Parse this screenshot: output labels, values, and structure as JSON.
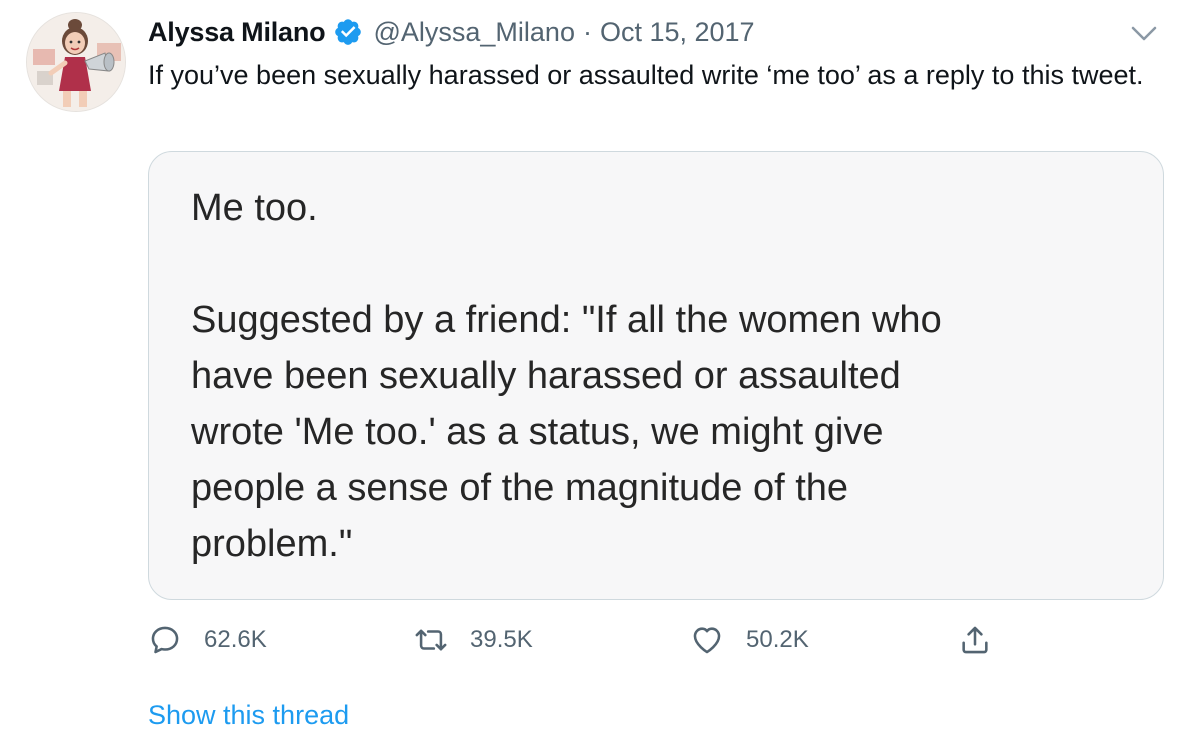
{
  "tweet": {
    "author": {
      "display_name": "Alyssa Milano",
      "verified": true,
      "handle": "@Alyssa_Milano",
      "avatar_icon": "cartoon-avatar-icon"
    },
    "separator": "·",
    "date": "Oct 15, 2017",
    "text": "If you’ve been sexually harassed or assaulted write ‘me too’ as a reply to this tweet.",
    "media": {
      "lines": [
        "Me too.",
        "Suggested by a friend: \"If all the women who",
        "have been sexually harassed or assaulted",
        "wrote 'Me too.' as a status, we might give",
        "people a sense of the magnitude of the",
        "problem.\""
      ]
    },
    "actions": {
      "reply_count": "62.6K",
      "retweet_count": "39.5K",
      "like_count": "50.2K"
    },
    "show_thread": "Show this thread"
  },
  "colors": {
    "link": "#1d9bf0",
    "verified": "#1d9bf0",
    "secondary_text": "#536471",
    "primary_text": "#0f1419",
    "media_border": "#cfd9de"
  }
}
